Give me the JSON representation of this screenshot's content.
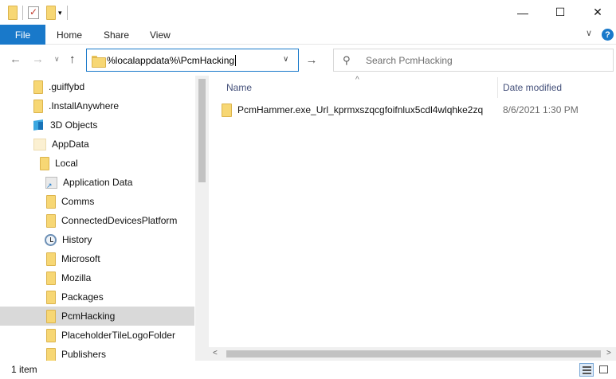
{
  "window": {
    "minimize_icon": "minimize-icon",
    "maximize_icon": "maximize-icon",
    "close_icon": "close-icon",
    "glyphs": {
      "minimize": "—",
      "maximize": "☐",
      "close": "✕"
    }
  },
  "ribbon": {
    "tabs": [
      {
        "label": "File"
      },
      {
        "label": "Home"
      },
      {
        "label": "Share"
      },
      {
        "label": "View"
      }
    ],
    "glyphs": {
      "expand": "∨",
      "help": "?"
    }
  },
  "nav": {
    "glyphs": {
      "back": "←",
      "forward": "→",
      "recent": "∨",
      "up": "↑",
      "dropdown": "∨",
      "refresh": "→",
      "search": "⚲"
    },
    "address": "%localappdata%\\PcmHacking",
    "search_placeholder": "Search PcmHacking"
  },
  "tree": {
    "items": [
      {
        "label": ".guiffybd",
        "icon": "folder-icon"
      },
      {
        "label": ".InstallAnywhere",
        "icon": "folder-icon"
      },
      {
        "label": "3D Objects",
        "icon": "3d-objects-icon"
      },
      {
        "label": "AppData",
        "icon": "appdata-folder-icon"
      },
      {
        "label": "Local",
        "icon": "folder-icon"
      },
      {
        "label": "Application Data",
        "icon": "shortcut-folder-icon"
      },
      {
        "label": "Comms",
        "icon": "folder-icon"
      },
      {
        "label": "ConnectedDevicesPlatform",
        "icon": "folder-icon"
      },
      {
        "label": "History",
        "icon": "history-icon"
      },
      {
        "label": "Microsoft",
        "icon": "folder-icon"
      },
      {
        "label": "Mozilla",
        "icon": "folder-icon"
      },
      {
        "label": "Packages",
        "icon": "folder-icon"
      },
      {
        "label": "PcmHacking",
        "icon": "folder-icon",
        "selected": true
      },
      {
        "label": "PlaceholderTileLogoFolder",
        "icon": "folder-icon"
      },
      {
        "label": "Publishers",
        "icon": "folder-icon"
      }
    ]
  },
  "content": {
    "sort_glyph": "^",
    "columns": {
      "name": "Name",
      "date": "Date modified"
    },
    "rows": [
      {
        "name": "PcmHammer.exe_Url_kprmxszqcgfoifnlux5cdl4wlqhke2zq",
        "date": "8/6/2021 1:30 PM"
      }
    ],
    "scroll_glyphs": {
      "left": "<",
      "right": ">"
    }
  },
  "status": {
    "item_count": "1 item"
  }
}
